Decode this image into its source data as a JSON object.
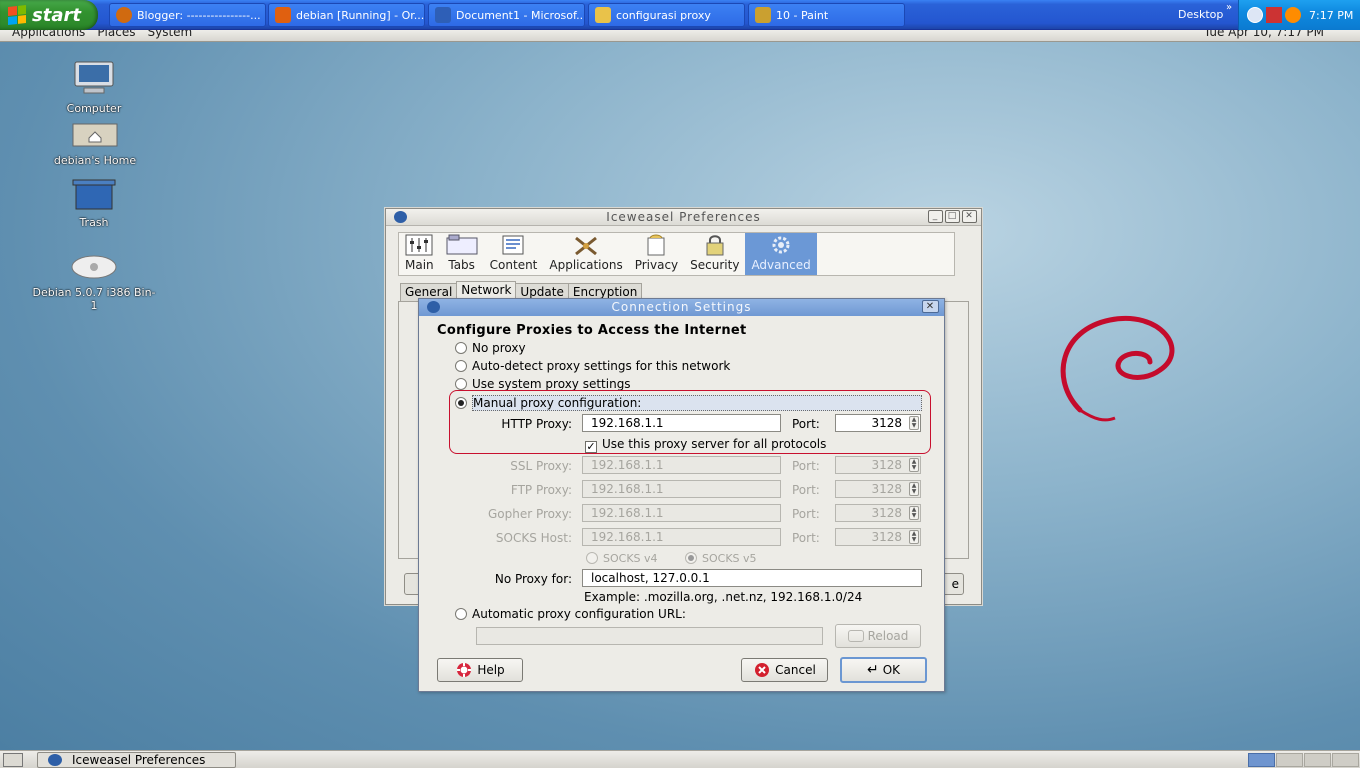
{
  "xp_taskbar": {
    "start_label": "start",
    "tasks": [
      {
        "label": "Blogger: ----------------...",
        "color": "#d06a10"
      },
      {
        "label": "debian [Running] - Or...",
        "color": "#e06010"
      },
      {
        "label": "Document1 - Microsof...",
        "color": "#2e5fb7"
      },
      {
        "label": "configurasi proxy",
        "color": "#e9c24a"
      },
      {
        "label": "10 - Paint",
        "color": "#caa030"
      }
    ],
    "desktop_label": "Desktop",
    "clock": "7:17 PM"
  },
  "gnome_panel": {
    "menus": [
      "Applications",
      "Places",
      "System"
    ],
    "clock": "Tue Apr 10,  7:17 PM"
  },
  "desktop_icons": [
    "Computer",
    "debian's Home",
    "Trash",
    "Debian 5.0.7 i386 Bin-1"
  ],
  "prefs": {
    "title": "Iceweasel Preferences",
    "panes": [
      "Main",
      "Tabs",
      "Content",
      "Applications",
      "Privacy",
      "Security",
      "Advanced"
    ],
    "tabs": [
      "General",
      "Network",
      "Update",
      "Encryption"
    ],
    "side_button_fragment": "e"
  },
  "conn": {
    "title": "Connection Settings",
    "heading": "Configure Proxies to Access the Internet",
    "opt_no_proxy": "No proxy",
    "opt_auto_detect": "Auto-detect proxy settings for this network",
    "opt_system": "Use system proxy settings",
    "opt_manual": "Manual proxy configuration:",
    "http_label": "HTTP Proxy:",
    "http_value": "192.168.1.1",
    "port_label": "Port:",
    "http_port": "3128",
    "all_protocols": "Use this proxy server for all protocols",
    "ssl_label": "SSL Proxy:",
    "ssl_value": "192.168.1.1",
    "ssl_port": "3128",
    "ftp_label": "FTP Proxy:",
    "ftp_value": "192.168.1.1",
    "ftp_port": "3128",
    "gopher_label": "Gopher Proxy:",
    "gopher_value": "192.168.1.1",
    "gopher_port": "3128",
    "socks_label": "SOCKS Host:",
    "socks_value": "192.168.1.1",
    "socks_port": "3128",
    "socks_v4": "SOCKS v4",
    "socks_v5": "SOCKS v5",
    "no_proxy_label": "No Proxy for:",
    "no_proxy_value": "localhost, 127.0.0.1",
    "example": "Example: .mozilla.org, .net.nz, 192.168.1.0/24",
    "opt_auto_url": "Automatic proxy configuration URL:",
    "auto_url_value": "",
    "reload_label": "Reload",
    "help_label": "Help",
    "cancel_label": "Cancel",
    "ok_label": "OK"
  },
  "bottom_panel": {
    "task_label": "Iceweasel Preferences"
  },
  "colors": {
    "highlight_box": "#c8102e",
    "active_pane": "#6b98d6"
  }
}
